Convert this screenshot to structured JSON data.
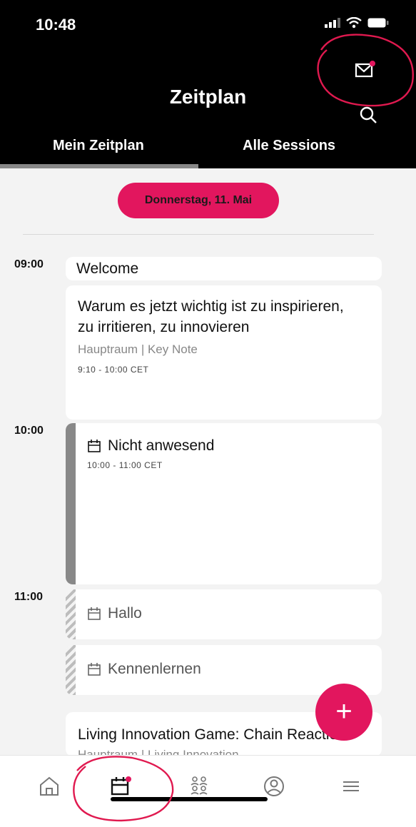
{
  "status": {
    "time": "10:48"
  },
  "header": {
    "title": "Zeitplan"
  },
  "tabs": [
    {
      "label": "Mein Zeitplan"
    },
    {
      "label": "Alle Sessions"
    }
  ],
  "date": "Donnerstag, 11. Mai",
  "timeslots": [
    "09:00",
    "10:00",
    "11:00"
  ],
  "sessions": [
    {
      "title": "Welcome"
    },
    {
      "title_line1": "Warum es jetzt wichtig ist zu inspirieren,",
      "title_line2": "zu irritieren, zu innovieren",
      "location": "Hauptraum | Key Note",
      "time": "9:10 - 10:00 CET"
    },
    {
      "title": "Nicht anwesend",
      "time": "10:00 - 11:00 CET"
    },
    {
      "title": "Hallo"
    },
    {
      "title": "Kennenlernen"
    },
    {
      "title": "Living Innovation Game: Chain Reaction",
      "location": "Hauptraum | Living Innovation"
    }
  ],
  "fab": {
    "symbol": "+"
  },
  "icons": {
    "mail": "mail-icon",
    "search": "search-icon",
    "home": "home-icon",
    "calendar": "calendar-icon",
    "people": "people-icon",
    "profile": "profile-icon",
    "menu": "menu-icon"
  },
  "colors": {
    "accent": "#e2165e",
    "header_bg": "#000000",
    "annotation": "#e0194f"
  }
}
